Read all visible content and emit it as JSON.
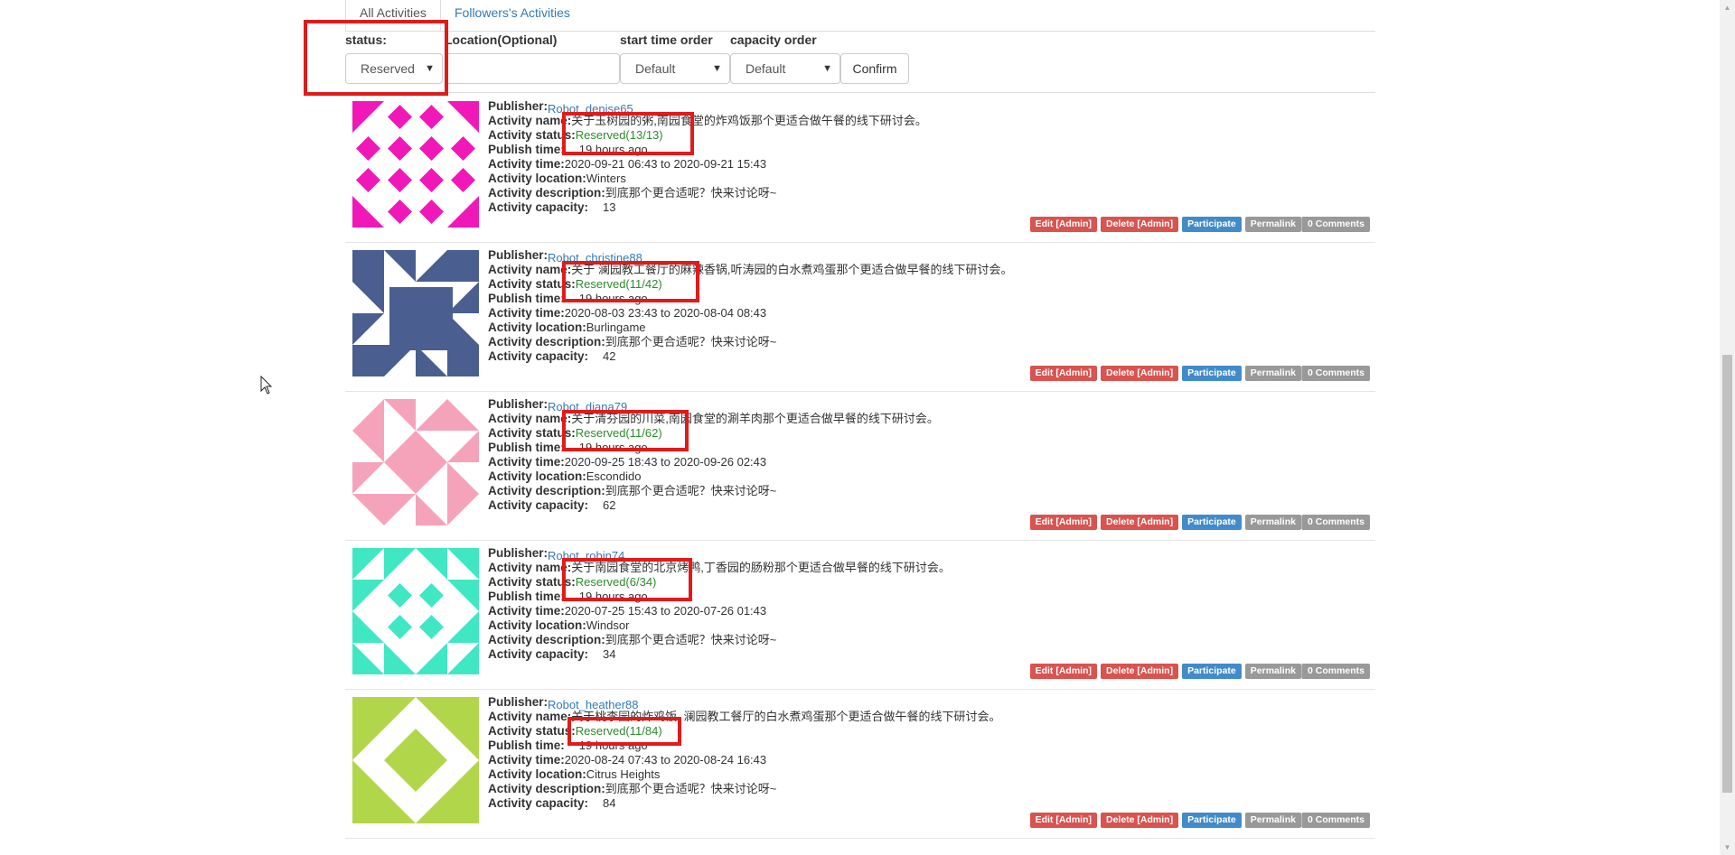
{
  "tabs": {
    "all": "All Activities",
    "followers": "Followers's Activities"
  },
  "filters": {
    "status_label": "status:",
    "status_value": "Reserved",
    "location_label": "Location(Optional)",
    "location_value": "",
    "start_time_label": "start time order",
    "start_time_value": "Default",
    "capacity_label": "capacity order",
    "capacity_value": "Default",
    "confirm": "Confirm"
  },
  "labels": {
    "publisher": "Publisher:",
    "name": "Activity name:",
    "status": "Activity status:",
    "publish_time": "Publish time:",
    "time": "Activity time:",
    "location": "Activity location:",
    "description": "Activity description:",
    "capacity": "Activity capacity:"
  },
  "buttons": {
    "edit": "Edit [Admin]",
    "delete": "Delete [Admin]",
    "participate": "Participate",
    "permalink": "Permalink",
    "comments": "0 Comments"
  },
  "activities": [
    {
      "publisher": "Robot_denise65",
      "name": "关于玉树园的粥,南园食堂的炸鸡饭那个更适合做午餐的线下研讨会。",
      "status": "Reserved(13/13)",
      "publish_time": "19 hours ago",
      "time": "2020-09-21 06:43 to 2020-09-21 15:43",
      "location": "Winters",
      "description": "到底那个更合适呢？快来讨论呀~",
      "capacity": "13",
      "avatar_color": "#f018b8"
    },
    {
      "publisher": "Robot_christine88",
      "name": "关于 澜园教工餐厅的麻辣香锅,听涛园的白水煮鸡蛋那个更适合做早餐的线下研讨会。",
      "status": "Reserved(11/42)",
      "publish_time": "19 hours ago",
      "time": "2020-08-03 23:43 to 2020-08-04 08:43",
      "location": "Burlingame",
      "description": "到底那个更合适呢？快来讨论呀~",
      "capacity": "42",
      "avatar_color": "#4a5e8f"
    },
    {
      "publisher": "Robot_diana79",
      "name": "关于清芬园的川菜,南园食堂的涮羊肉那个更适合做早餐的线下研讨会。",
      "status": "Reserved(11/62)",
      "publish_time": "19 hours ago",
      "time": "2020-09-25 18:43 to 2020-09-26 02:43",
      "location": "Escondido",
      "description": "到底那个更合适呢？快来讨论呀~",
      "capacity": "62",
      "avatar_color": "#f5a3bb"
    },
    {
      "publisher": "Robot_robin74",
      "name": "关于南园食堂的北京烤鸭,丁香园的肠粉那个更适合做早餐的线下研讨会。",
      "status": "Reserved(6/34)",
      "publish_time": "19 hours ago",
      "time": "2020-07-25 15:43 to 2020-07-26 01:43",
      "location": "Windsor",
      "description": "到底那个更合适呢？快来讨论呀~",
      "capacity": "34",
      "avatar_color": "#3fe8c2"
    },
    {
      "publisher": "Robot_heather88",
      "name": "关于桃李园的炸鸡饭, 澜园教工餐厅的白水煮鸡蛋那个更适合做午餐的线下研讨会。",
      "status": "Reserved(11/84)",
      "publish_time": "19 hours ago",
      "time": "2020-08-24 07:43 to 2020-08-24 16:43",
      "location": "Citrus Heights",
      "description": "到底那个更合适呢？快来讨论呀~",
      "capacity": "84",
      "avatar_color": "#b2d649"
    }
  ]
}
